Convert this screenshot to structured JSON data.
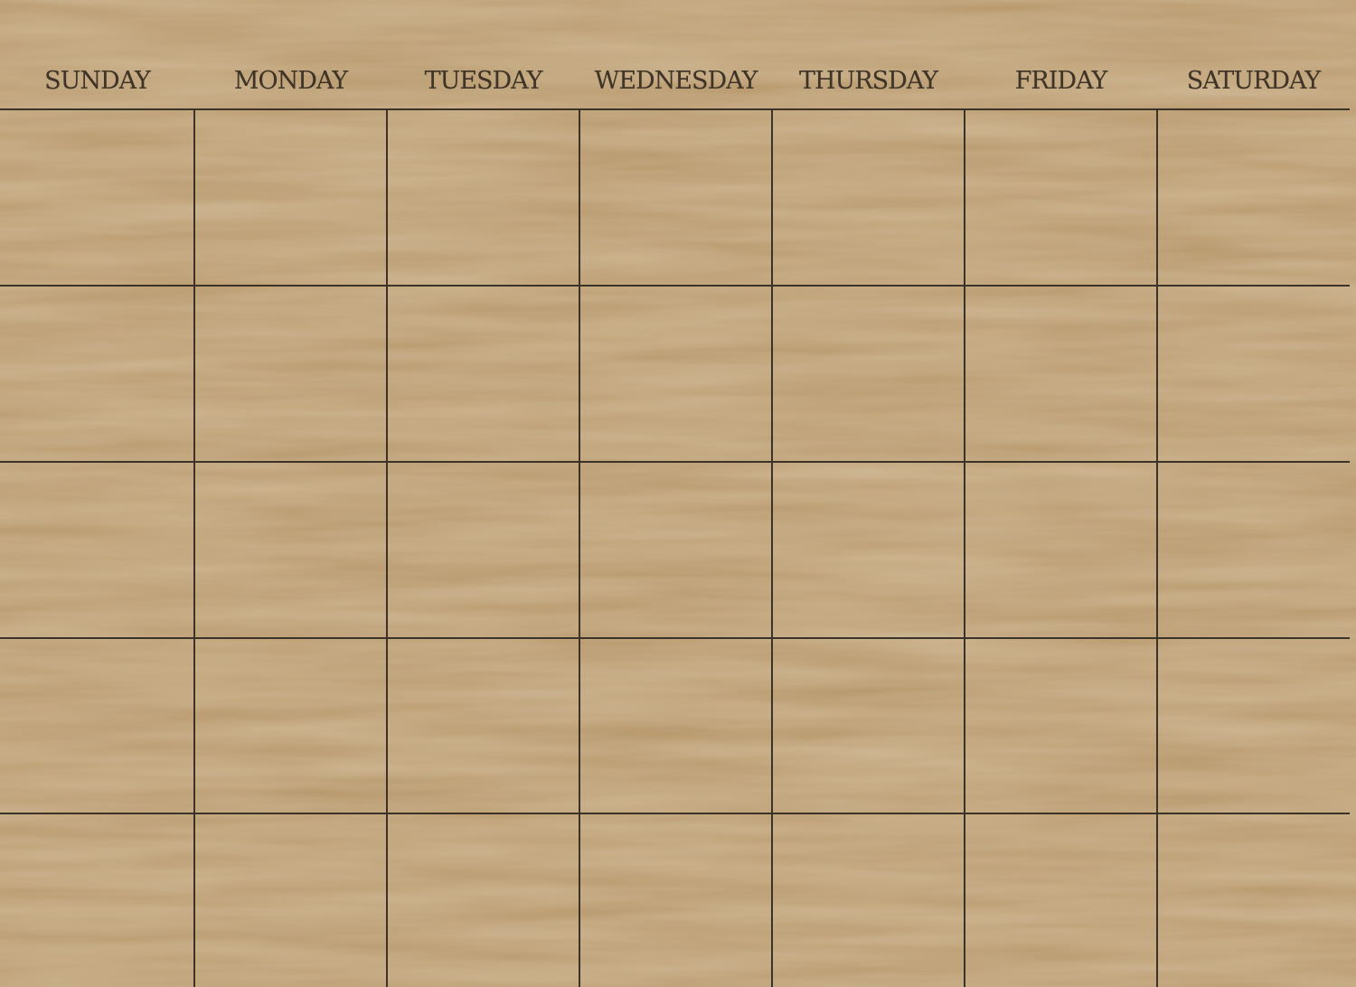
{
  "calendar": {
    "days": [
      "SUNDAY",
      "MONDAY",
      "TUESDAY",
      "WEDNESDAY",
      "THURSDAY",
      "FRIDAY",
      "SATURDAY"
    ],
    "weeks": 5
  },
  "colors": {
    "wood_base": "#b99a6e",
    "wood_light": "#c9ab7e",
    "wood_dark": "#a98a5e",
    "line": "#3d3227",
    "text": "#3f3427"
  }
}
